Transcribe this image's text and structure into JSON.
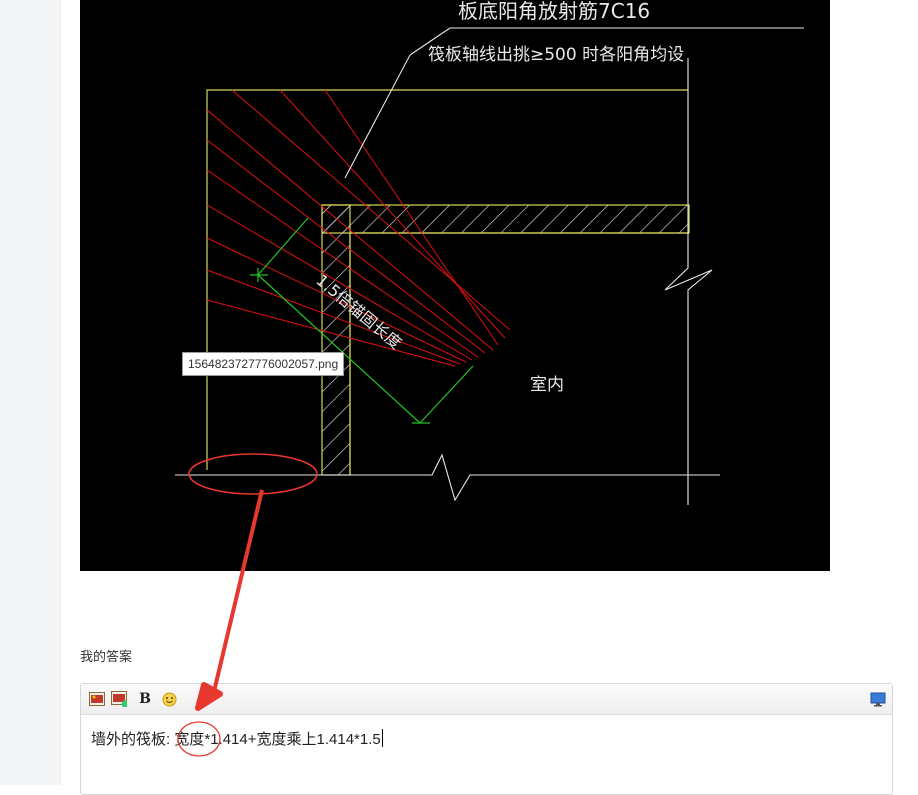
{
  "cad": {
    "top_label": "板底阳角放射筋7C16",
    "note": "筏板轴线出挑≥500 时各阳角均设",
    "dimension": "1.5倍锚固长度",
    "room_label": "室内"
  },
  "tooltip": {
    "filename": "1564823727776002057.png"
  },
  "answer": {
    "heading": "我的答案",
    "content_prefix": "墙外的筏板:",
    "content_circled": "宽度",
    "content_rest": "*1.414+宽度乘上1.414*1.5"
  },
  "toolbar": {
    "icons": [
      "image-icon",
      "image-upload-icon",
      "bold-icon",
      "emoji-icon",
      "preview-icon"
    ],
    "bold_label": "B"
  },
  "colors": {
    "cad_background": "#000000",
    "cad_yellow": "#d6d65a",
    "cad_red": "#e01010",
    "cad_green": "#22c422",
    "annotation_red": "#e8372f"
  }
}
